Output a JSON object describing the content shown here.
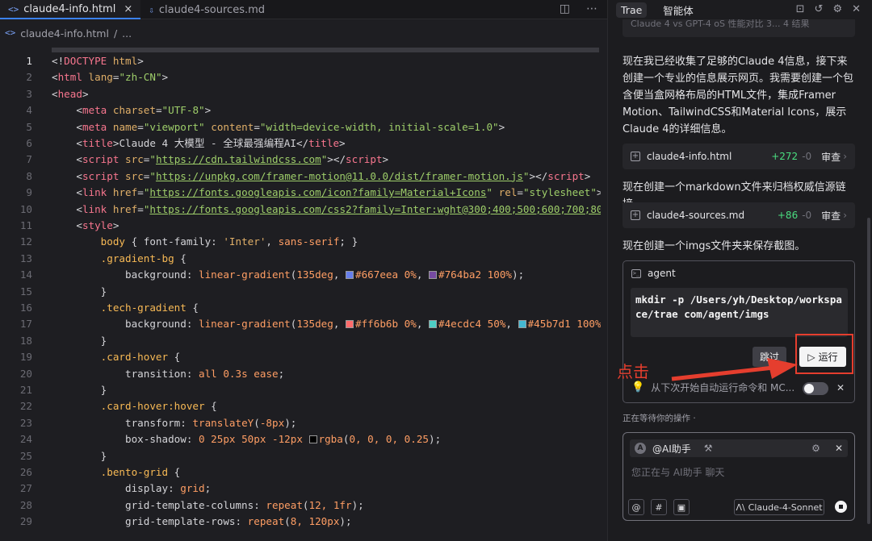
{
  "tabs": [
    {
      "icon": "<>",
      "label": "claude4-info.html",
      "close": "×"
    },
    {
      "icon": "⇩",
      "label": "claude4-sources.md"
    }
  ],
  "breadcrumb": {
    "icon": "<>",
    "file": "claude4-info.html",
    "sep": "/",
    "more": "..."
  },
  "code": {
    "current_line": 1,
    "line_numbers": [
      "1",
      "2",
      "3",
      "4",
      "5",
      "6",
      "7",
      "8",
      "9",
      "10",
      "11",
      "12",
      "13",
      "14",
      "15",
      "16",
      "17",
      "18",
      "19",
      "20",
      "21",
      "22",
      "23",
      "24",
      "25",
      "26",
      "27",
      "28",
      "29"
    ]
  },
  "panel": {
    "tabs": [
      "Trae",
      "智能体"
    ],
    "top_card": "Claude 4 vs GPT-4 oS 性能对比 3...   4 结果",
    "msg1": "现在我已经收集了足够的Claude 4信息，接下来创建一个专业的信息展示网页。我需要创建一个包含便当盒网格布局的HTML文件，集成Framer Motion、TailwindCSS和Material Icons，展示Claude 4的详细信息。",
    "file1": {
      "name": "claude4-info.html",
      "added": "+272",
      "removed": "-0",
      "review": "审查"
    },
    "msg2": "现在创建一个markdown文件来归档权威信源链接。",
    "file2": {
      "name": "claude4-sources.md",
      "added": "+86",
      "removed": "-0",
      "review": "审查"
    },
    "msg3": "现在创建一个imgs文件夹来保存截图。",
    "agent": {
      "label": "agent",
      "command": "mkdir -p /Users/yh/Desktop/workspace/trae com/agent/imgs",
      "skip": "跳过",
      "run": "运行",
      "auto_run": "从下次开始自动运行命令和 MC..."
    },
    "waiting": "正在等待你的操作  ·",
    "input": {
      "mention": "@AI助手",
      "placeholder": "您正在与 AI助手 聊天",
      "model": "Claude-4-Sonnet"
    }
  },
  "annotation": {
    "text": "点击",
    "color": "#e53e2e"
  }
}
